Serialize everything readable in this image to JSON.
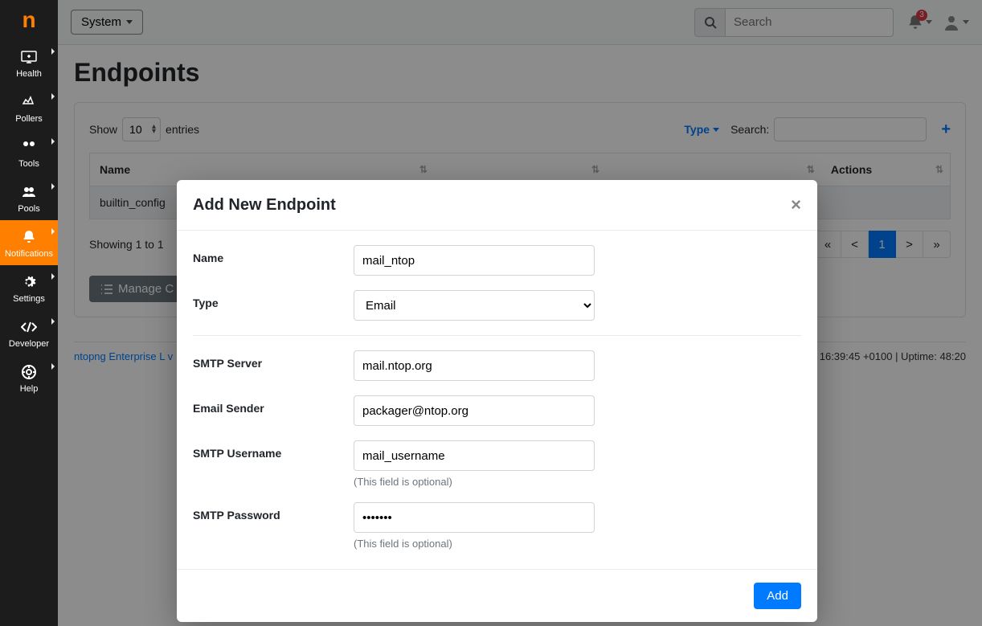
{
  "logo": "n",
  "sidebar": {
    "items": [
      {
        "label": "Health"
      },
      {
        "label": "Pollers"
      },
      {
        "label": "Tools"
      },
      {
        "label": "Pools"
      },
      {
        "label": "Notifications"
      },
      {
        "label": "Settings"
      },
      {
        "label": "Developer"
      },
      {
        "label": "Help"
      }
    ]
  },
  "topbar": {
    "system_label": "System",
    "search_placeholder": "Search",
    "notification_count": "3"
  },
  "page_title": "Endpoints",
  "table": {
    "show_label": "Show",
    "entries_label": "entries",
    "per_page": "10",
    "type_label": "Type",
    "search_label": "Search:",
    "columns": {
      "name": "Name",
      "actions": "Actions"
    },
    "row_name": "builtin_config",
    "showing_text": "Showing 1 to 1",
    "page_current": "1",
    "manage_label": "Manage C"
  },
  "footer": {
    "left": "ntopng Enterprise L v",
    "right": "16:39:45 +0100 | Uptime: 48:20"
  },
  "modal": {
    "title": "Add New Endpoint",
    "name_label": "Name",
    "name_value": "mail_ntop",
    "type_label": "Type",
    "type_value": "Email",
    "smtp_server_label": "SMTP Server",
    "smtp_server_value": "mail.ntop.org",
    "email_sender_label": "Email Sender",
    "email_sender_value": "packager@ntop.org",
    "smtp_user_label": "SMTP Username",
    "smtp_user_value": "mail_username",
    "smtp_pass_label": "SMTP Password",
    "smtp_pass_value": "•••••••",
    "optional_hint": "(This field is optional)",
    "add_button": "Add"
  }
}
